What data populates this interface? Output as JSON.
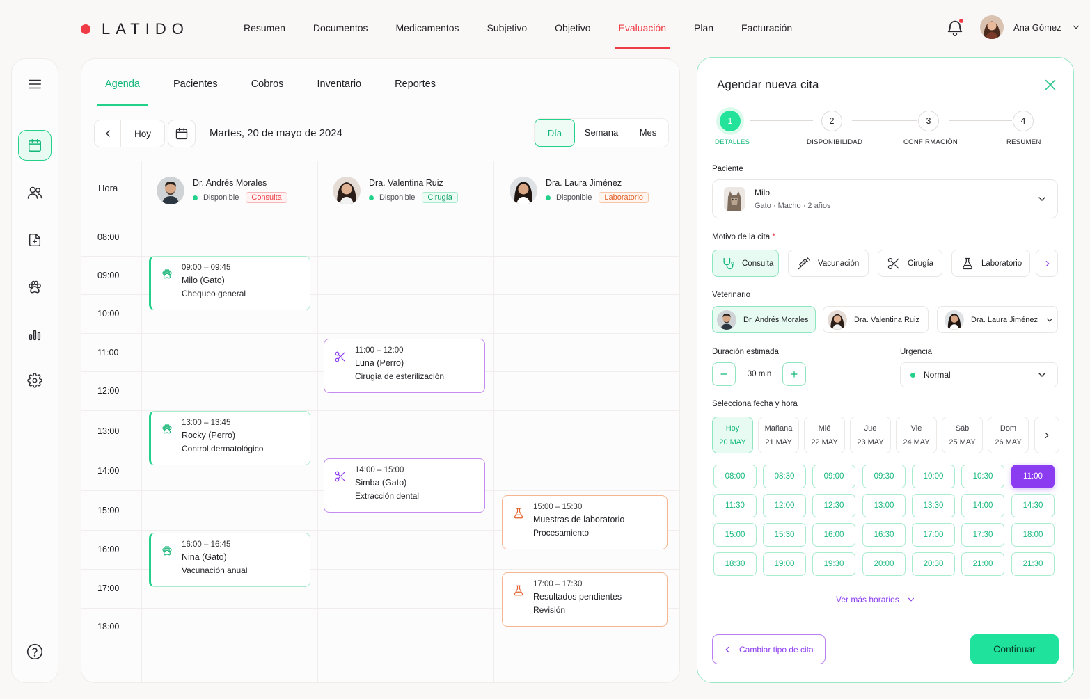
{
  "brand": {
    "name": "LATIDO",
    "accent": "#ee3b45"
  },
  "topnav": [
    "Resumen",
    "Documentos",
    "Medicamentos",
    "Subjetivo",
    "Objetivo",
    "Evaluación",
    "Plan",
    "Facturación"
  ],
  "topnav_active": "Evaluación",
  "user": {
    "name": "Ana Gómez",
    "notification": true
  },
  "sidebar": [
    "menu-icon",
    "calendar-icon",
    "users-icon",
    "document-icon",
    "paw-icon",
    "chart-icon",
    "gear-icon",
    "help-icon"
  ],
  "tabs": [
    "Agenda",
    "Pacientes",
    "Cobros",
    "Inventario",
    "Reportes"
  ],
  "datebar": {
    "today": "Hoy",
    "date": "Martes, 20 de mayo de 2024"
  },
  "views": [
    "Día",
    "Semana",
    "Mes"
  ],
  "hour_label": "Hora",
  "hours": [
    "08:00",
    "09:00",
    "10:00",
    "11:00",
    "12:00",
    "13:00",
    "14:00",
    "15:00",
    "16:00",
    "17:00",
    "18:00"
  ],
  "doctors": [
    {
      "name": "Dr. Andrés Morales",
      "status": "Disponible",
      "tag": "Consulta"
    },
    {
      "name": "Dra. Valentina Ruiz",
      "status": "Disponible",
      "tag": "Cirugía"
    },
    {
      "name": "Dra. Laura Jiménez",
      "status": "Disponible",
      "tag": "Laboratorio"
    }
  ],
  "appointments": [
    {
      "time": "09:00 – 09:45",
      "patient": "Milo (Gato)",
      "desc": "Chequeo general",
      "kind": "consulta"
    },
    {
      "time": "13:00 – 13:45",
      "patient": "Rocky (Perro)",
      "desc": "Control dermatológico",
      "kind": "consulta"
    },
    {
      "time": "16:00 – 16:45",
      "patient": "Nina (Gato)",
      "desc": "Vacunación anual",
      "kind": "consulta"
    },
    {
      "time": "11:00 – 12:00",
      "patient": "Luna (Perro)",
      "desc": "Cirugía de esterilización",
      "kind": "cirugia"
    },
    {
      "time": "14:00 – 15:00",
      "patient": "Simba (Gato)",
      "desc": "Extracción dental",
      "kind": "cirugia"
    },
    {
      "time": "15:00 – 15:30",
      "patient": "Muestras de laboratorio",
      "desc": "Procesamiento",
      "kind": "lab"
    },
    {
      "time": "17:00 – 17:30",
      "patient": "Resultados pendientes",
      "desc": "Revisión",
      "kind": "lab"
    }
  ],
  "panel": {
    "title": "Agendar nueva cita",
    "steps": [
      {
        "num": "1",
        "label": "DETALLES"
      },
      {
        "num": "2",
        "label": "DISPONIBILIDAD"
      },
      {
        "num": "3",
        "label": "CONFIRMACIÓN"
      },
      {
        "num": "4",
        "label": "RESUMEN"
      }
    ],
    "patient_label": "Paciente",
    "patient": {
      "name": "Milo",
      "info": "Gato · Macho · 2 años"
    },
    "reason_label": "Motivo de la cita",
    "reason_required": "*",
    "reasons": [
      "Consulta",
      "Vacunación",
      "Cirugía",
      "Laboratorio"
    ],
    "vet_label": "Veterinario",
    "vets": [
      "Dr. Andrés Morales",
      "Dra. Valentina Ruiz",
      "Dra. Laura Jiménez"
    ],
    "duration_label": "Duración estimada",
    "duration": "30 min",
    "urgency_label": "Urgencia",
    "urgency": "Normal",
    "datetime_label": "Selecciona fecha y hora",
    "days": [
      {
        "name": "Hoy",
        "date": "20 MAY"
      },
      {
        "name": "Mañana",
        "date": "21 MAY"
      },
      {
        "name": "Mié",
        "date": "22 MAY"
      },
      {
        "name": "Jue",
        "date": "23 MAY"
      },
      {
        "name": "Vie",
        "date": "24 MAY"
      },
      {
        "name": "Sáb",
        "date": "25 MAY"
      },
      {
        "name": "Dom",
        "date": "26 MAY"
      }
    ],
    "slots": [
      "08:00",
      "08:30",
      "09:00",
      "09:30",
      "10:00",
      "10:30",
      "11:00",
      "11:30",
      "12:00",
      "12:30",
      "13:00",
      "13:30",
      "14:00",
      "14:30",
      "15:00",
      "15:30",
      "16:00",
      "16:30",
      "17:00",
      "17:30",
      "18:00",
      "18:30",
      "19:00",
      "19:30",
      "20:00",
      "20:30",
      "21:00",
      "21:30"
    ],
    "selected_slot": "11:00",
    "more": "Ver más horarios",
    "back": "Cambiar tipo de cita",
    "continue": "Continuar"
  },
  "colors": {
    "green": "#23d18b",
    "purple": "#8b3cf0",
    "orange": "#f5b591",
    "red": "#ee3b45"
  }
}
